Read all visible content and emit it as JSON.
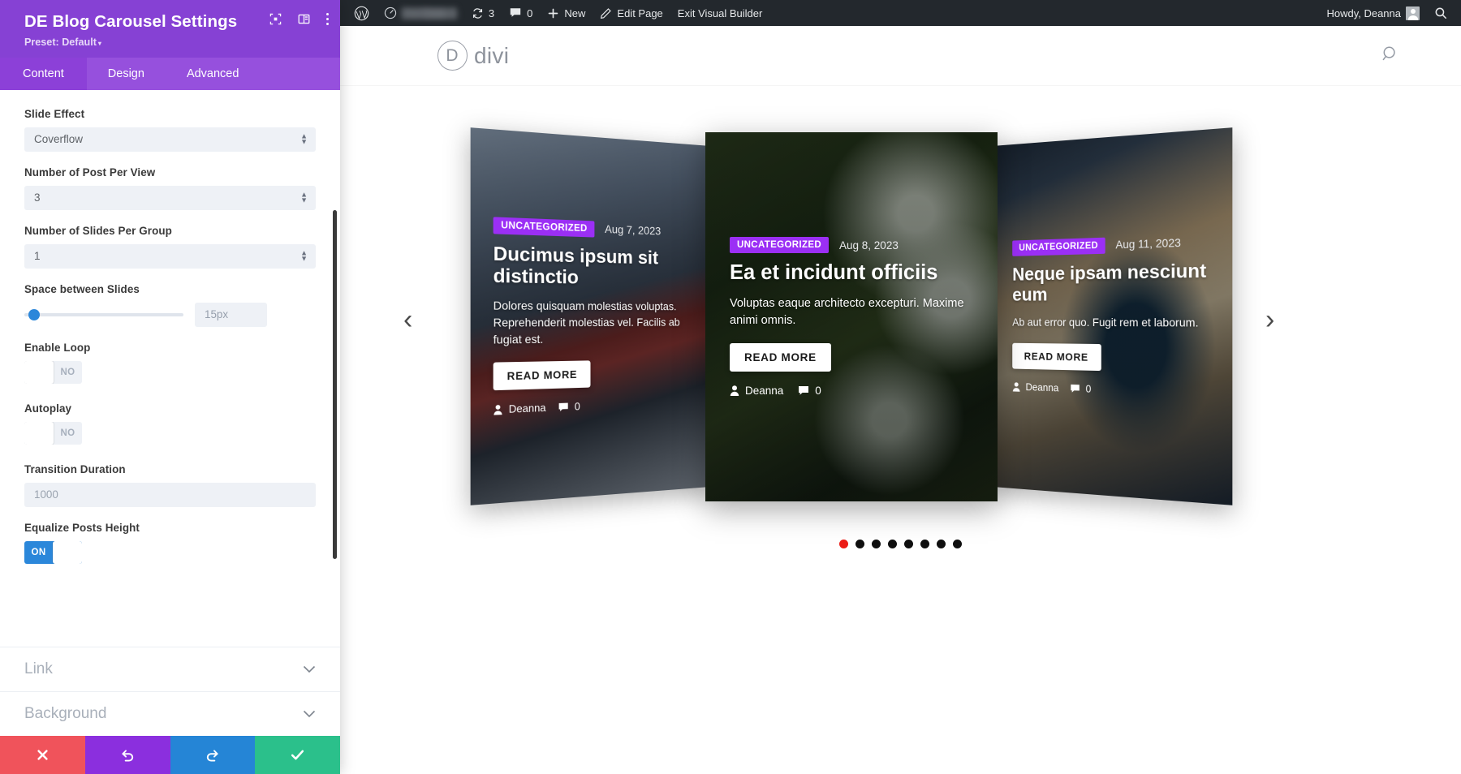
{
  "panel": {
    "title": "DE Blog Carousel Settings",
    "preset": "Preset: Default",
    "tabs": [
      {
        "label": "Content",
        "active": true
      },
      {
        "label": "Design",
        "active": false
      },
      {
        "label": "Advanced",
        "active": false
      }
    ],
    "fields": {
      "slide_effect": {
        "label": "Slide Effect",
        "value": "Coverflow"
      },
      "posts_per_view": {
        "label": "Number of Post Per View",
        "value": "3"
      },
      "slides_per_group": {
        "label": "Number of Slides Per Group",
        "value": "1"
      },
      "space_between": {
        "label": "Space between Slides",
        "value": "15px",
        "slider_percent": 6
      },
      "enable_loop": {
        "label": "Enable Loop",
        "state": "NO",
        "on": false
      },
      "autoplay": {
        "label": "Autoplay",
        "state": "NO",
        "on": false
      },
      "transition_duration": {
        "label": "Transition Duration",
        "value": "1000"
      },
      "equalize_heights": {
        "label": "Equalize Posts Height",
        "state": "ON",
        "on": true
      }
    },
    "accordions": [
      {
        "label": "Link",
        "icon": "chevron-down-icon"
      },
      {
        "label": "Background",
        "icon": "chevron-down-icon"
      }
    ],
    "actions": [
      {
        "name": "discard-button",
        "icon": "close-icon",
        "color": "#f0535b"
      },
      {
        "name": "undo-button",
        "icon": "undo-icon",
        "color": "#8b2fde"
      },
      {
        "name": "redo-button",
        "icon": "redo-icon",
        "color": "#2585d6"
      },
      {
        "name": "save-button",
        "icon": "check-icon",
        "color": "#2bc08b"
      }
    ],
    "header_icons": [
      {
        "name": "fullscreen-icon"
      },
      {
        "name": "layout-columns-icon"
      },
      {
        "name": "more-options-icon"
      }
    ]
  },
  "adminbar": {
    "wp_logo": "wordpress-logo-icon",
    "site_name": "",
    "updates_count": "3",
    "comments_count": "0",
    "new_label": "New",
    "edit_page_label": "Edit Page",
    "exit_builder_label": "Exit Visual Builder",
    "howdy": "Howdy, Deanna",
    "search_icon": "search-icon"
  },
  "site_header": {
    "logo_letter": "D",
    "logo_word": "divi",
    "search_icon": "search-icon"
  },
  "carousel": {
    "prev_arrow": "‹",
    "next_arrow": "›",
    "pager": {
      "count": 8,
      "active_index": 0,
      "active_color": "#ec1c16",
      "inactive_color": "#0f0f0f"
    },
    "slides": [
      {
        "category": "UNCATEGORIZED",
        "date": "Aug 7, 2023",
        "title": "Ducimus ipsum sit distinctio",
        "excerpt": "Dolores quisquam molestias voluptas. Reprehenderit molestias vel. Facilis ab fugiat est.",
        "button": "READ MORE",
        "author": "Deanna",
        "comments": "0"
      },
      {
        "category": "UNCATEGORIZED",
        "date": "Aug 8, 2023",
        "title": "Ea et incidunt officiis",
        "excerpt": "Voluptas eaque architecto excepturi. Maxime animi omnis.",
        "button": "READ MORE",
        "author": "Deanna",
        "comments": "0"
      },
      {
        "category": "UNCATEGORIZED",
        "date": "Aug 11, 2023",
        "title": "Neque ipsam nesciunt eum",
        "excerpt": "Ab aut error quo. Fugit rem et laborum.",
        "button": "READ MORE",
        "author": "Deanna",
        "comments": "0"
      }
    ]
  },
  "colors": {
    "panel_purple": "#8641d4",
    "tab_purple": "#9650dd",
    "badge_purple": "#9b2ff5",
    "toggle_blue": "#2b87da",
    "adminbar": "#23282d"
  }
}
